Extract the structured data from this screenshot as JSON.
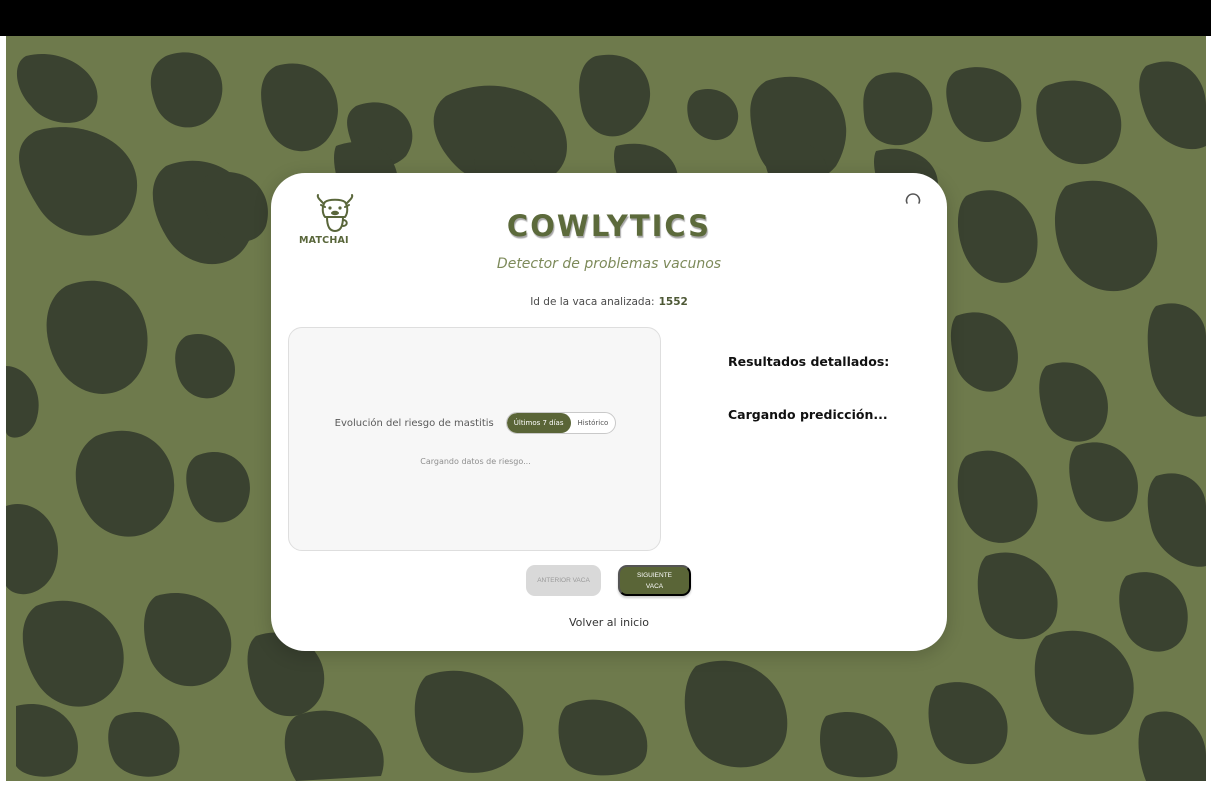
{
  "brand": {
    "logo_text": "MATCHAI",
    "app_title": "COWLYTICS",
    "subtitle": "Detector de problemas vacunos"
  },
  "cow": {
    "id_label": "Id de la vaca analizada:",
    "id_value": "1552"
  },
  "chart_panel": {
    "title": "Evolución del riesgo de mastitis",
    "range_options": [
      "Últimos 7 días",
      "Histórico"
    ],
    "selected_range": "Últimos 7 días",
    "status": "Cargando datos de riesgo..."
  },
  "results": {
    "heading": "Resultados detallados:",
    "status": "Cargando predicción..."
  },
  "navigation": {
    "prev_label": "ANTERIOR VACA",
    "next_label": "SIGUIENTE VACA",
    "home_label": "Volver al inicio"
  },
  "icons": {
    "logo": "cow-cup-logo-icon",
    "loading": "loading-spinner-icon"
  },
  "colors": {
    "background_light": "#6e7a4c",
    "background_spots": "#3a4230",
    "accent": "#5a6537",
    "title": "#5c6a3b",
    "card": "#ffffff",
    "disabled_button": "#d9d9d9"
  }
}
